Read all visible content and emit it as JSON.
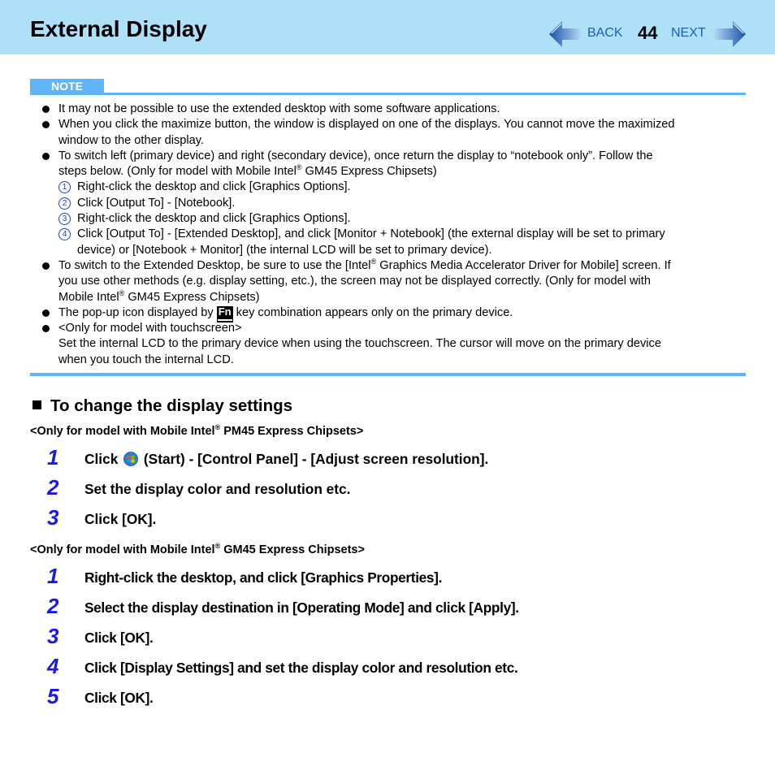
{
  "header": {
    "title": "External Display",
    "back_label": "BACK",
    "next_label": "NEXT",
    "page_number": "44",
    "colors": {
      "header_bg": "#aee0f8",
      "nav_text": "#1a5fb4"
    }
  },
  "note": {
    "label": "NOTE",
    "accent_color": "#63b3f7",
    "bullets": [
      {
        "text": "It may not be possible to use the extended desktop with some software applications."
      },
      {
        "line1": "When you click the maximize button, the window is displayed on one of the displays. You cannot move the maximized",
        "line2": "window to the other display."
      },
      {
        "line1": "To switch left (primary device) and right (secondary device), once return the display to “notebook only”. Follow the",
        "line2_pre": "steps below. (Only for model with Mobile Intel",
        "line2_sup": "®",
        "line2_post": " GM45 Express Chipsets)",
        "sub_steps": [
          {
            "num": "1",
            "text": "Right-click the desktop and click [Graphics Options]."
          },
          {
            "num": "2",
            "text": "Click [Output To] - [Notebook]."
          },
          {
            "num": "3",
            "text": "Right-click the desktop and click [Graphics Options]."
          },
          {
            "num": "4",
            "line1": "Click [Output To] - [Extended Desktop], and click [Monitor + Notebook] (the external display will be set to primary",
            "line2": "device) or [Notebook + Monitor] (the internal LCD will be set to primary device)."
          }
        ]
      },
      {
        "line1_pre": "To switch to the Extended Desktop, be sure to use the [Intel",
        "line1_sup": "®",
        "line1_post": " Graphics Media Accelerator Driver for Mobile] screen. If",
        "line2": "you use other methods (e.g. display setting, etc.), the screen may not be displayed correctly. (Only for model with",
        "line3_pre": "Mobile Intel",
        "line3_sup": "®",
        "line3_post": " GM45 Express Chipsets)"
      },
      {
        "pre": "The pop-up icon displayed by ",
        "key": "Fn",
        "post": " key combination appears only on the primary device."
      },
      {
        "line1": "<Only for model with touchscreen>",
        "line2": "Set the internal LCD to the primary device when using the touchscreen. The cursor will move on the primary device",
        "line3": "when you touch the internal LCD."
      }
    ]
  },
  "section": {
    "heading": "To change the display settings",
    "step_color": "#1a1ae6",
    "groups": [
      {
        "label_pre": "<Only for model with Mobile Intel",
        "label_sup": "®",
        "label_post": " PM45 Express Chipsets>",
        "steps": [
          {
            "num": "1",
            "pre": "Click ",
            "icon": "windows-start-icon",
            "post": " (Start) - [Control Panel] - [Adjust screen resolution]."
          },
          {
            "num": "2",
            "text": "Set the display color and resolution etc."
          },
          {
            "num": "3",
            "text": "Click [OK]."
          }
        ]
      },
      {
        "label_pre": "<Only for model with Mobile Intel",
        "label_sup": "®",
        "label_post": " GM45 Express Chipsets>",
        "steps": [
          {
            "num": "1",
            "text": "Right-click the desktop, and click [Graphics Properties]."
          },
          {
            "num": "2",
            "text": "Select the display destination in [Operating Mode] and click [Apply]."
          },
          {
            "num": "3",
            "text": "Click [OK]."
          },
          {
            "num": "4",
            "text": "Click [Display Settings] and set the display color and resolution etc."
          },
          {
            "num": "5",
            "text": "Click [OK]."
          }
        ]
      }
    ]
  }
}
